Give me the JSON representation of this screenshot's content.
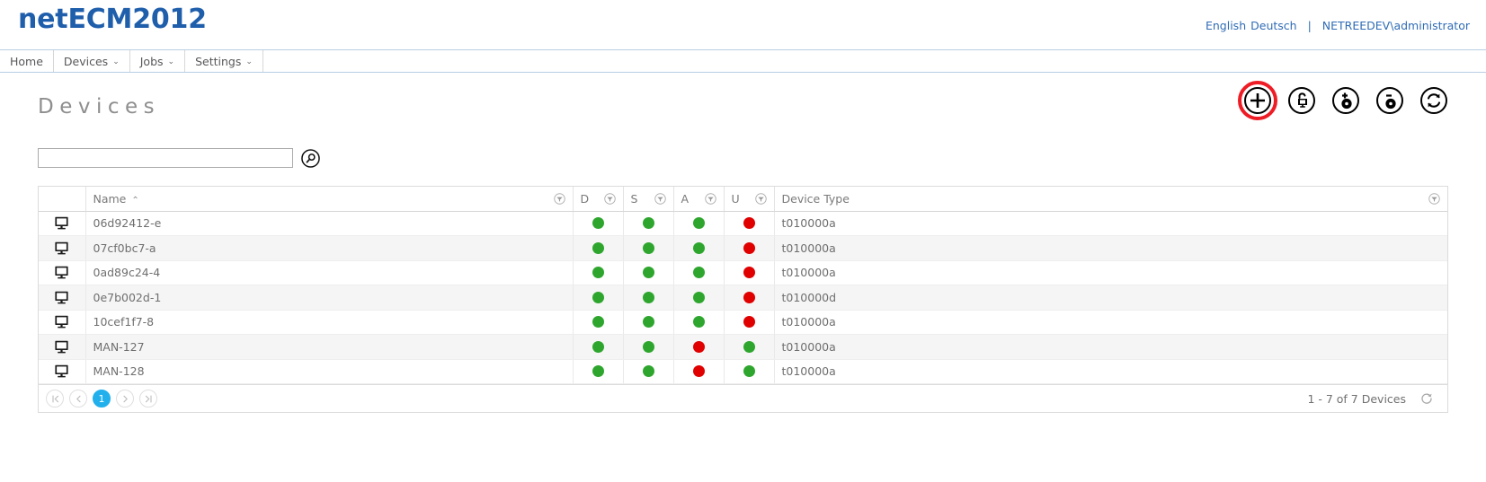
{
  "header": {
    "brand": "netECM2012",
    "lang_english": "English",
    "lang_deutsch": "Deutsch",
    "separator": "|",
    "user": "NETREEDEV\\administrator"
  },
  "nav": {
    "items": [
      {
        "label": "Home",
        "caret": ""
      },
      {
        "label": "Devices",
        "caret": "⌄"
      },
      {
        "label": "Jobs",
        "caret": "⌄"
      },
      {
        "label": "Settings",
        "caret": "⌄"
      }
    ]
  },
  "page": {
    "title": "Devices"
  },
  "toolbar": {
    "buttons": [
      {
        "name": "add-device-button",
        "icon": "plus-circle-icon",
        "highlighted": true
      },
      {
        "name": "unlock-device-button",
        "icon": "unlock-device-icon",
        "highlighted": false
      },
      {
        "name": "add-disk-button",
        "icon": "add-disk-icon",
        "highlighted": false
      },
      {
        "name": "remove-disk-button",
        "icon": "remove-disk-icon",
        "highlighted": false
      },
      {
        "name": "refresh-button",
        "icon": "refresh-circle-icon",
        "highlighted": false
      }
    ]
  },
  "search": {
    "value": "",
    "placeholder": ""
  },
  "table": {
    "columns": [
      {
        "key": "icon",
        "label": "",
        "filter": false,
        "sort": ""
      },
      {
        "key": "name",
        "label": "Name",
        "filter": true,
        "sort": "asc",
        "sort_caret": "⌃"
      },
      {
        "key": "d",
        "label": "D",
        "filter": true,
        "sort": ""
      },
      {
        "key": "s",
        "label": "S",
        "filter": true,
        "sort": ""
      },
      {
        "key": "a",
        "label": "A",
        "filter": true,
        "sort": ""
      },
      {
        "key": "u",
        "label": "U",
        "filter": true,
        "sort": ""
      },
      {
        "key": "type",
        "label": "Device Type",
        "filter": true,
        "sort": ""
      }
    ],
    "rows": [
      {
        "name": "06d92412-e",
        "d": "green",
        "s": "green",
        "a": "green",
        "u": "red",
        "type": "t010000a"
      },
      {
        "name": "07cf0bc7-a",
        "d": "green",
        "s": "green",
        "a": "green",
        "u": "red",
        "type": "t010000a"
      },
      {
        "name": "0ad89c24-4",
        "d": "green",
        "s": "green",
        "a": "green",
        "u": "red",
        "type": "t010000a"
      },
      {
        "name": "0e7b002d-1",
        "d": "green",
        "s": "green",
        "a": "green",
        "u": "red",
        "type": "t010000d"
      },
      {
        "name": "10cef1f7-8",
        "d": "green",
        "s": "green",
        "a": "green",
        "u": "red",
        "type": "t010000a"
      },
      {
        "name": "MAN-127",
        "d": "green",
        "s": "green",
        "a": "red",
        "u": "green",
        "type": "t010000a"
      },
      {
        "name": "MAN-128",
        "d": "green",
        "s": "green",
        "a": "red",
        "u": "green",
        "type": "t010000a"
      }
    ]
  },
  "pager": {
    "first": "⏪",
    "prev": "‹",
    "pages": [
      "1"
    ],
    "active_page": "1",
    "next": "›",
    "last": "⏩",
    "info": "1 - 7 of 7 Devices"
  },
  "colors": {
    "brand": "#1f5eab",
    "link": "#2f6cb5",
    "status_green": "#2ea62e",
    "status_red": "#e00000",
    "highlight_ring": "#ee1c25",
    "pager_active": "#21b0ec"
  }
}
